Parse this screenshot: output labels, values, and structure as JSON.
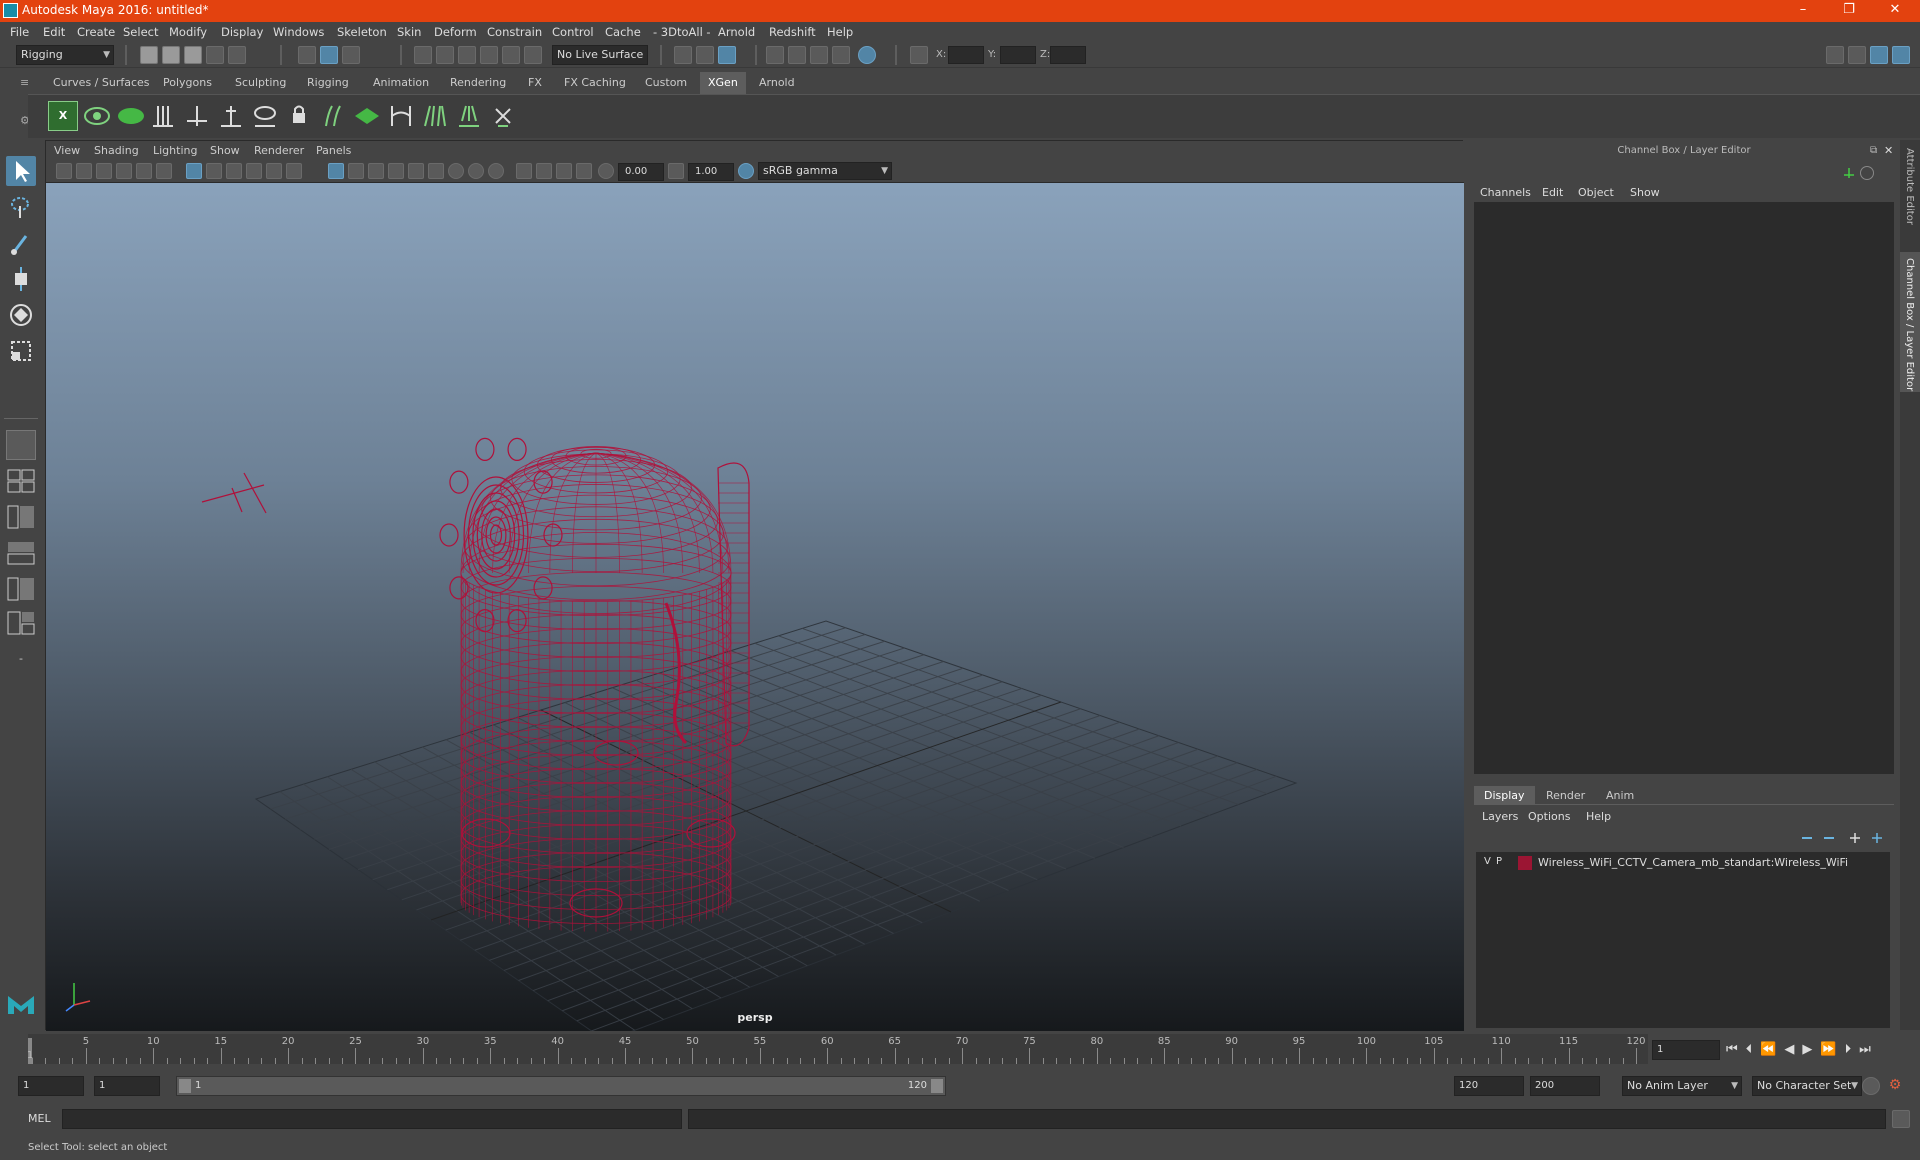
{
  "window": {
    "title": "Autodesk Maya 2016: untitled*",
    "minimize": "–",
    "maximize": "❐",
    "close": "✕"
  },
  "menubar": [
    "File",
    "Edit",
    "Create",
    "Select",
    "Modify",
    "Display",
    "Windows",
    "Skeleton",
    "Skin",
    "Deform",
    "Constrain",
    "Control",
    "Cache",
    "- 3DtoAll -",
    "Arnold",
    "Redshift",
    "Help"
  ],
  "statusline": {
    "mode": "Rigging",
    "live_surface": "No Live Surface",
    "x_label": "X:",
    "y_label": "Y:",
    "z_label": "Z:"
  },
  "shelf_tabs": [
    "Curves / Surfaces",
    "Polygons",
    "Sculpting",
    "Rigging",
    "Animation",
    "Rendering",
    "FX",
    "FX Caching",
    "Custom",
    "XGen",
    "Arnold"
  ],
  "shelf_active": "XGen",
  "viewport": {
    "menu": [
      "View",
      "Shading",
      "Lighting",
      "Show",
      "Renderer",
      "Panels"
    ],
    "exposure": "0.00",
    "gamma": "1.00",
    "color_space": "sRGB gamma",
    "camera": "persp",
    "wire_color": "#b0103a"
  },
  "channel_box": {
    "header": "Channel Box / Layer Editor",
    "menu": [
      "Channels",
      "Edit",
      "Object",
      "Show"
    ]
  },
  "side_tabs": [
    "Attribute Editor",
    "Channel Box / Layer Editor"
  ],
  "layer_editor": {
    "tabs": [
      "Display",
      "Render",
      "Anim"
    ],
    "active_tab": "Display",
    "menu": [
      "Layers",
      "Options",
      "Help"
    ],
    "layers": [
      {
        "v": "V",
        "p": "P",
        "color": "#9b1533",
        "name": "Wireless_WiFi_CCTV_Camera_mb_standart:Wireless_WiFi"
      }
    ]
  },
  "timeline": {
    "ticks": [
      5,
      10,
      15,
      20,
      25,
      30,
      35,
      40,
      45,
      50,
      55,
      60,
      65,
      70,
      75,
      80,
      85,
      90,
      95,
      100,
      105,
      110,
      115,
      120
    ],
    "start_label": "1",
    "current_frame": "1"
  },
  "range": {
    "start": "1",
    "start2": "1",
    "slider_start": "1",
    "slider_end": "120",
    "end": "120",
    "end2": "200",
    "anim_layer": "No Anim Layer",
    "char_set": "No Character Set"
  },
  "cmdline": {
    "lang": "MEL"
  },
  "helpline": "Select Tool: select an object"
}
